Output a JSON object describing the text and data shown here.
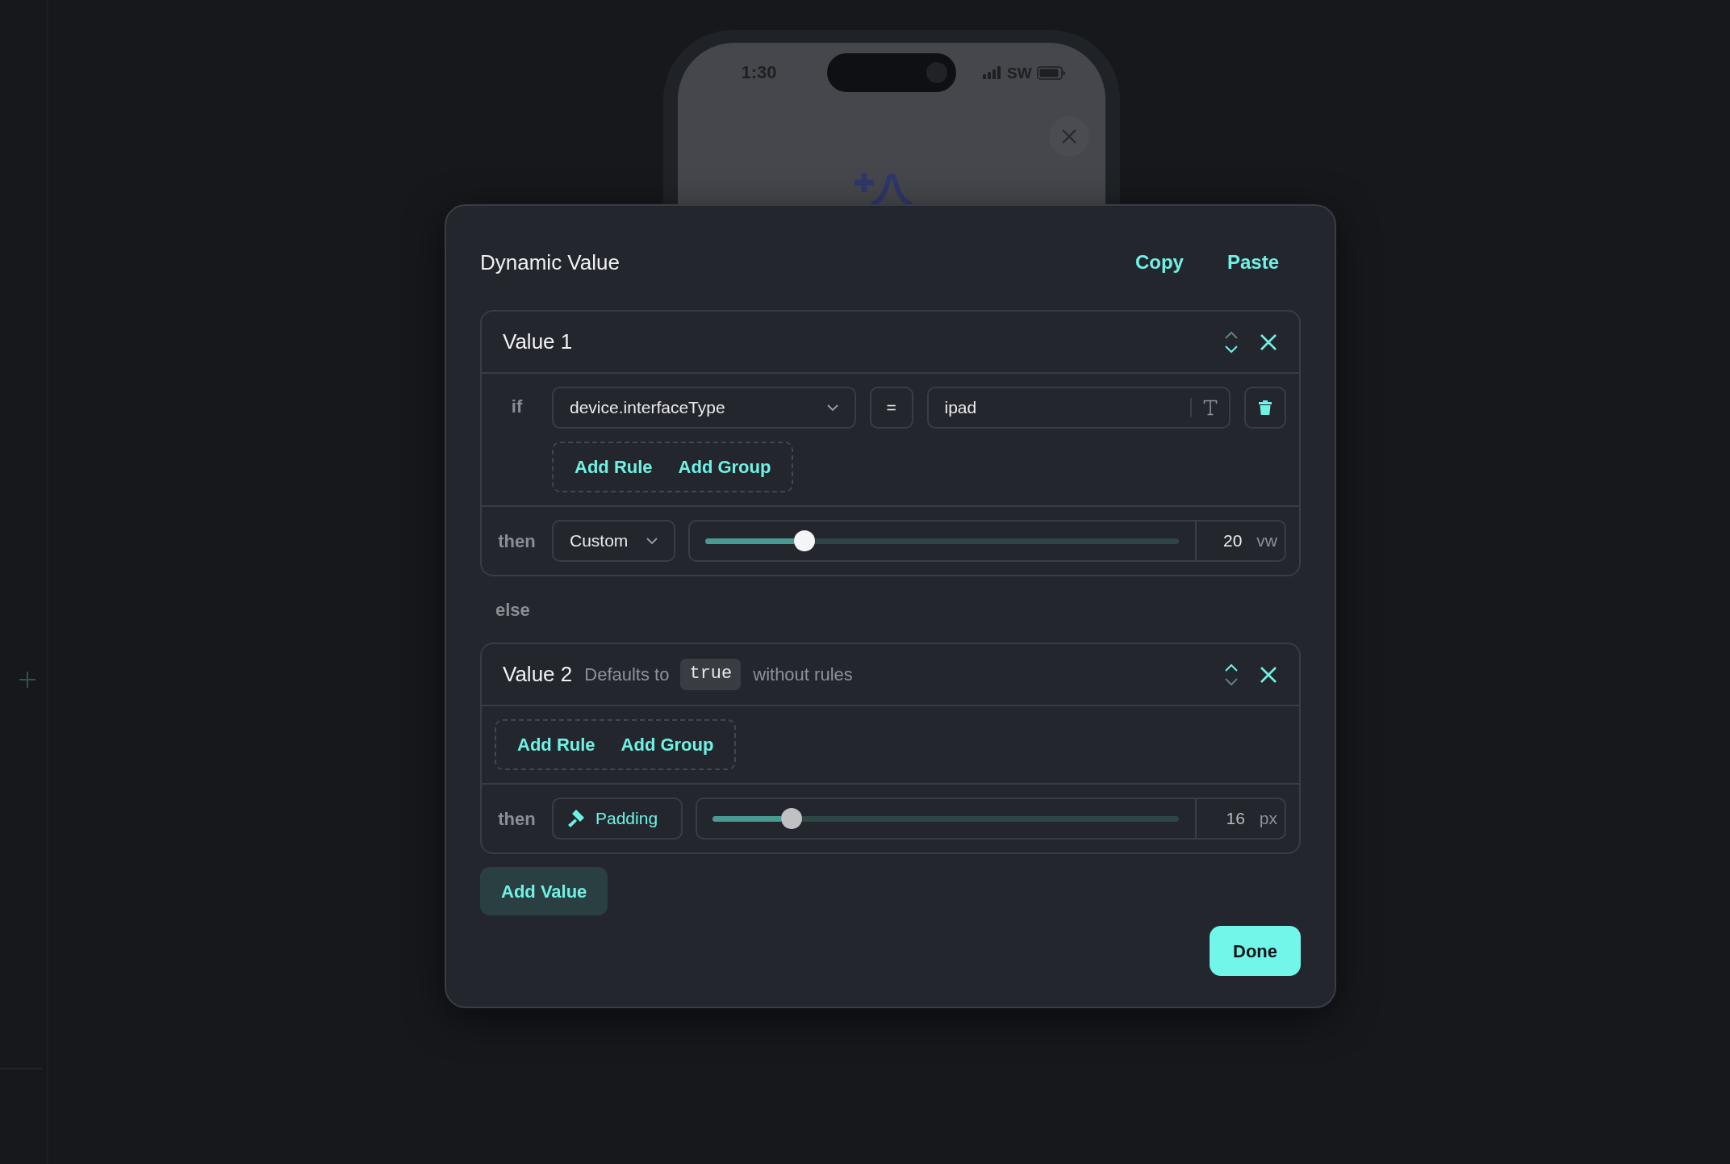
{
  "phone": {
    "time": "1:30",
    "carrier": "SW"
  },
  "dialog": {
    "title": "Dynamic Value",
    "actions": [
      "Copy",
      "Paste"
    ],
    "values": [
      {
        "title": "Value 1",
        "move_up_enabled": false,
        "move_down_enabled": true,
        "condition_label": "if",
        "rules": [
          {
            "field": "device.interfaceType",
            "operator": "=",
            "value": "ipad"
          }
        ],
        "add_actions": [
          "Add Rule",
          "Add Group"
        ],
        "result_label": "then",
        "result": {
          "kind": "select",
          "label": "Custom"
        },
        "slider": {
          "level": 0.21,
          "disabled": false,
          "reading": "20",
          "unit": "vw"
        }
      },
      {
        "lead": "else",
        "title": "Value 2",
        "default_note": {
          "before": "Defaults to",
          "code": "true",
          "after": "without rules"
        },
        "move_up_enabled": true,
        "move_down_enabled": false,
        "add_actions": [
          "Add Rule",
          "Add Group"
        ],
        "result_label": "then",
        "result": {
          "kind": "token",
          "label": "Padding"
        },
        "slider": {
          "level": 0.17,
          "disabled": true,
          "reading": "16",
          "unit": "px"
        }
      }
    ],
    "add_value": "Add Value",
    "done": "Done"
  }
}
